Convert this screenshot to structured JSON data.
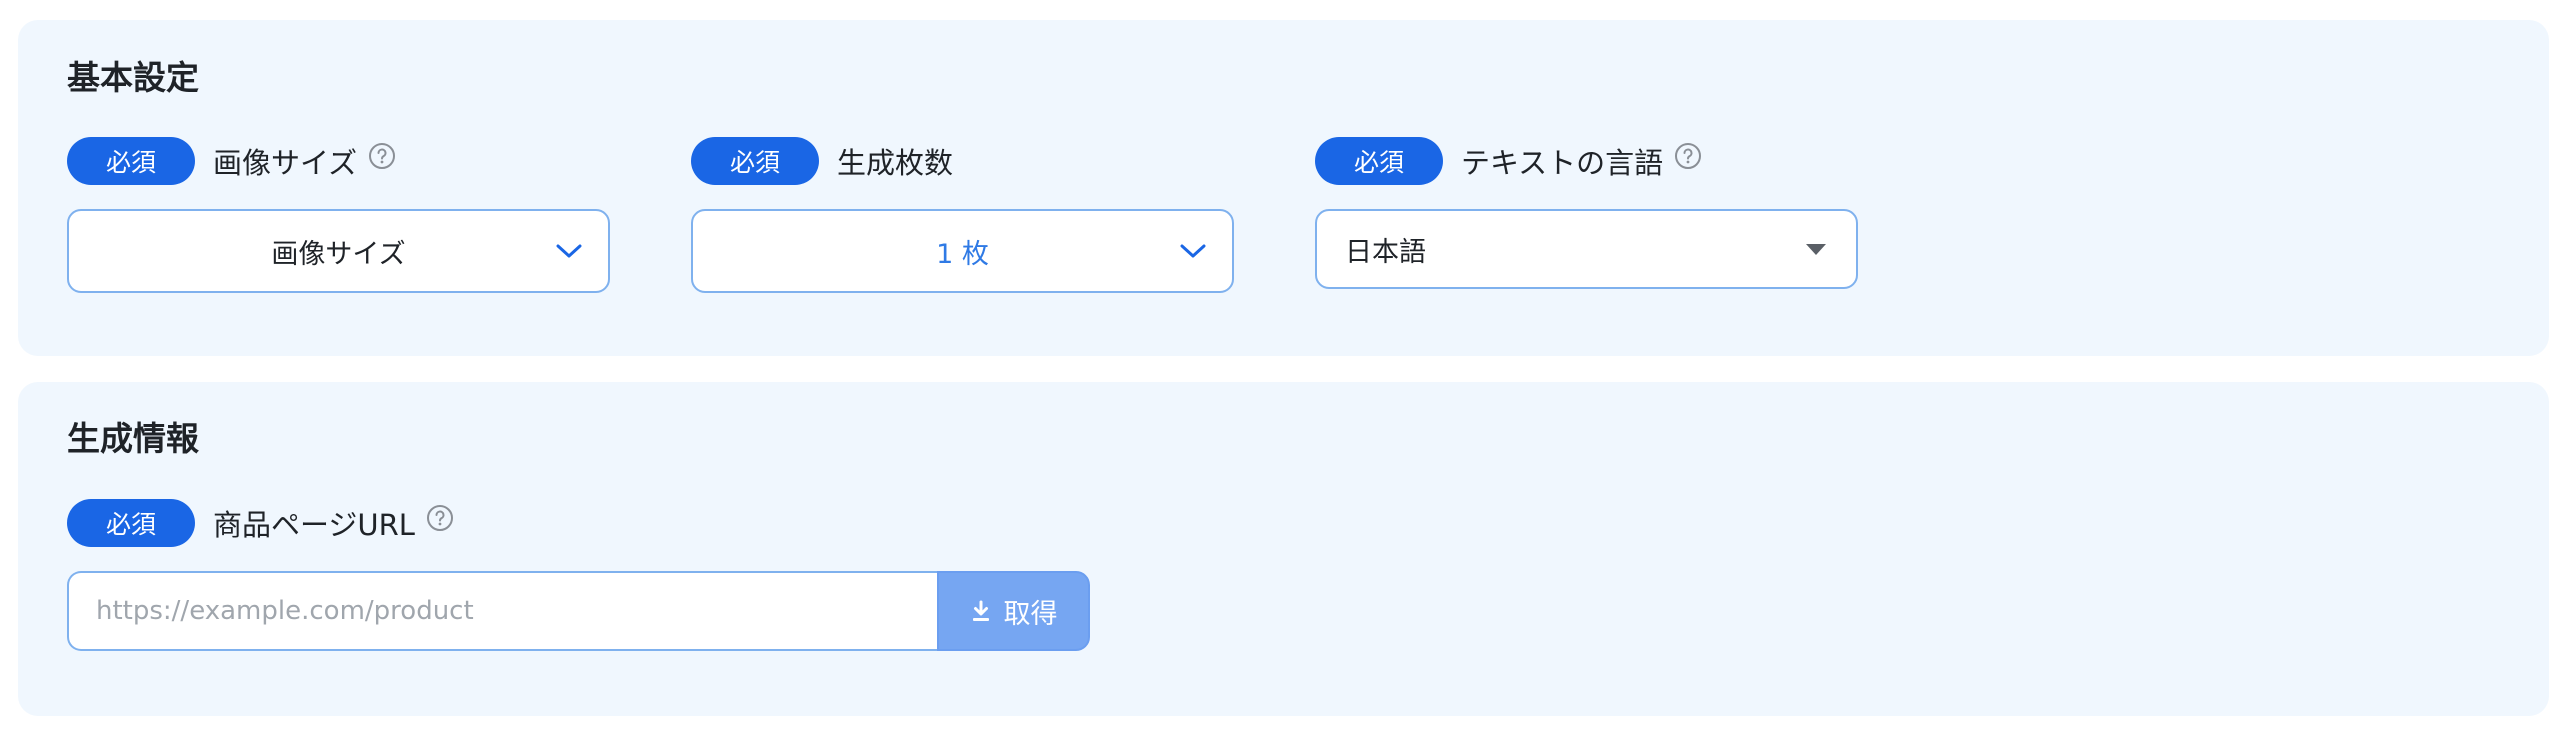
{
  "basic_settings": {
    "title": "基本設定",
    "image_size": {
      "badge": "必須",
      "label": "画像サイズ",
      "value": "画像サイズ"
    },
    "count": {
      "badge": "必須",
      "label": "生成枚数",
      "value": "1 枚"
    },
    "text_language": {
      "badge": "必須",
      "label": "テキストの言語",
      "value": "日本語"
    }
  },
  "generation_info": {
    "title": "生成情報",
    "product_url": {
      "badge": "必須",
      "label": "商品ページURL",
      "placeholder": "https://example.com/product",
      "value": "",
      "button_label": "取得"
    }
  },
  "colors": {
    "card_background": "#f0f7fe",
    "badge": "#1a66e5",
    "border": "#7fb1ee",
    "button": "#76a6f2",
    "count_value": "#2f7ae5",
    "chevron": "#1a66e5"
  },
  "icons": {
    "help": "question-circle-icon",
    "dropdown": "chevron-down-icon",
    "caret": "caret-down-icon",
    "fetch": "download-icon"
  }
}
